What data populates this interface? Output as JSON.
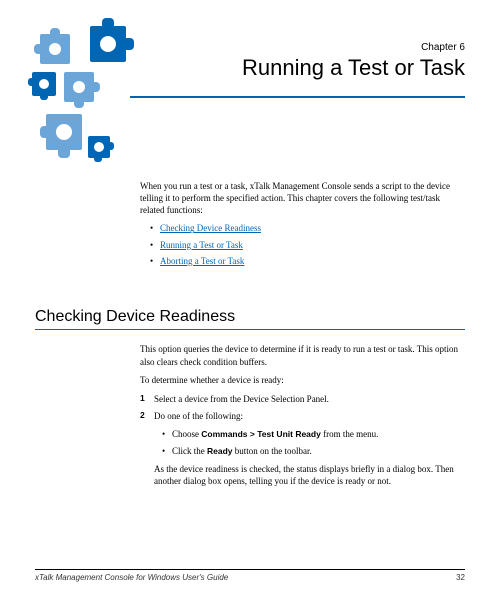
{
  "chapter": {
    "label": "Chapter 6",
    "title": "Running a Test or Task"
  },
  "intro": {
    "paragraph": "When you run a test or a task, xTalk Management Console sends a script to the device telling it to perform the specified action. This chapter covers the following test/task related functions:",
    "links": [
      "Checking Device Readiness",
      "Running a Test or Task",
      "Aborting a Test or Task"
    ]
  },
  "section": {
    "heading": "Checking Device Readiness",
    "p1": "This option queries the device to determine if it is ready to run a test or task. This option also clears check condition buffers.",
    "p2": "To determine whether a device is ready:",
    "steps": [
      {
        "num": "1",
        "text": "Select a device from the Device Selection Panel."
      },
      {
        "num": "2",
        "text": "Do one of the following:"
      }
    ],
    "substeps": {
      "a_pre": "Choose ",
      "a_bold": "Commands > Test Unit Ready",
      "a_post": " from the menu.",
      "b_pre": "Click the ",
      "b_bold": "Ready",
      "b_post": " button on the toolbar."
    },
    "p3": "As the device readiness is checked, the status displays briefly in a dialog box. Then another dialog box opens, telling you if the device is ready or not."
  },
  "footer": {
    "doc": "xTalk Management Console for Windows User's Guide",
    "page": "32"
  }
}
